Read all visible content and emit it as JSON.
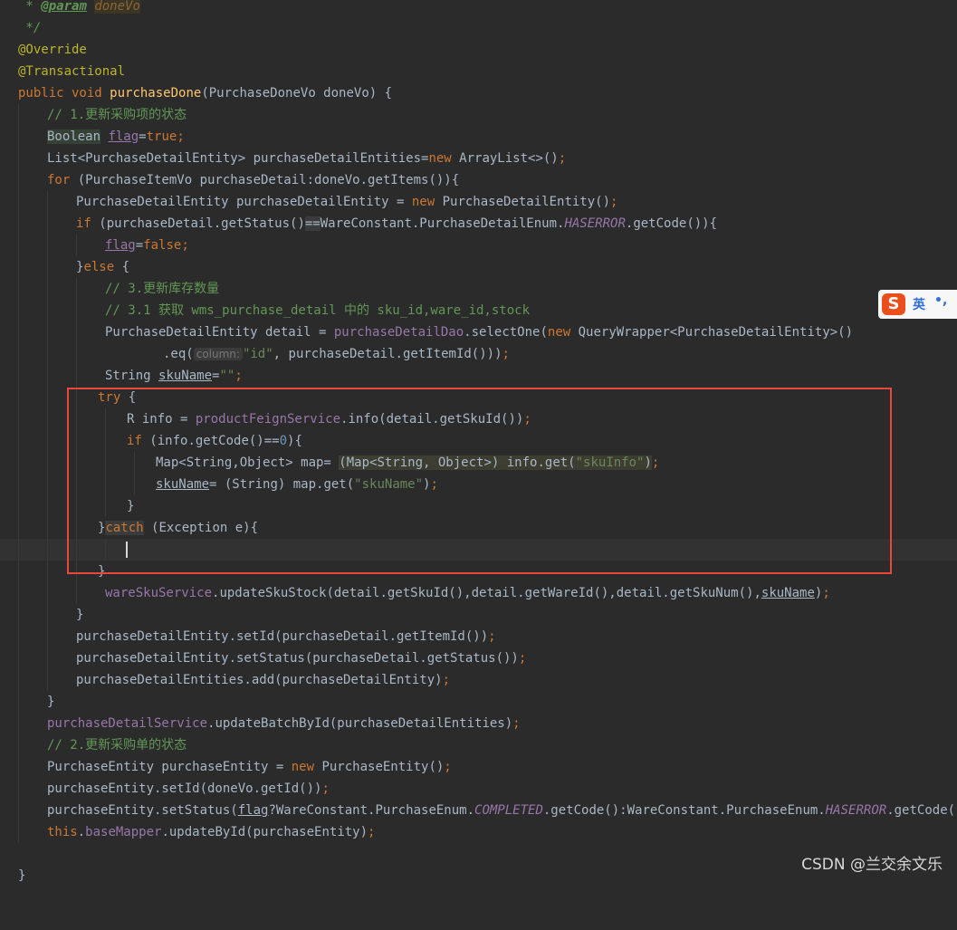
{
  "code": {
    "doc_star": " * ",
    "doc_param_tag": "@param",
    "doc_param_name": "doneVo",
    "doc_close": " */",
    "override": "@Override",
    "transactional": "@Transactional",
    "l3_public": "public void ",
    "l3_fn": "purchaseDone",
    "l3_rest": "(PurchaseDoneVo doneVo) {",
    "l4_comment": "// 1.更新采购项的状态",
    "l5_type": "Boolean",
    "l5_var": "flag",
    "l5_eq": "=",
    "l5_val": "true",
    "semi": ";",
    "l6_a": "List<PurchaseDetailEntity> purchaseDetailEntities=",
    "l6_new": "new ",
    "l6_b": "ArrayList<>()",
    "l7_for": "for ",
    "l7_rest": "(PurchaseItemVo purchaseDetail:doneVo.getItems()){",
    "l8_a": "PurchaseDetailEntity purchaseDetailEntity = ",
    "l8_new": "new ",
    "l8_b": "PurchaseDetailEntity()",
    "l9_if": "if ",
    "l9_a": "(purchaseDetail.getStatus()",
    "l9_eqeq": "==",
    "l9_b": "WareConstant.PurchaseDetailEnum.",
    "l9_enum": "HASERROR",
    "l9_c": ".getCode()){",
    "l10_var": "flag",
    "l10_eq": "=",
    "l10_val": "false",
    "l11_a": "}",
    "l11_else": "else ",
    "l11_b": "{",
    "l12_comment": "// 3.更新库存数量",
    "l13_comment": "// 3.1 获取 wms_purchase_detail 中的 sku_id,ware_id,stock",
    "l14_a": "PurchaseDetailEntity detail = ",
    "l14_dao": "purchaseDetailDao",
    "l14_b": ".selectOne(",
    "l14_new": "new ",
    "l14_c": "QueryWrapper<PurchaseDetailEntity>()",
    "l15_a": ".eq(",
    "l15_hint": "column:",
    "l15_str": "\"id\"",
    "l15_b": ", purchaseDetail.getItemId()))",
    "l16_a": "String ",
    "l16_var": "skuName",
    "l16_eq": "=",
    "l16_str": "\"\"",
    "l17_try": "try ",
    "l17_b": "{",
    "l18_a": "R info = ",
    "l18_svc": "productFeignService",
    "l18_b": ".info(detail.getSkuId())",
    "l19_if": "if ",
    "l19_a": "(info.getCode()==",
    "l19_num": "0",
    "l19_b": "){",
    "l20_a": "Map<String,Object> map= ",
    "l20_cast": "(Map<String, Object>)",
    "l20_b": " info.get(",
    "l20_str": "\"skuInfo\"",
    "l20_c": ")",
    "l21_var": "skuName",
    "l21_a": "= (String) map.get(",
    "l21_str": "\"skuName\"",
    "l21_b": ")",
    "close_brace": "}",
    "l23_a": "}",
    "l23_catch": "catch",
    "l23_b": " (Exception e){",
    "l26_svc": "wareSkuService",
    "l26_a": ".updateSkuStock(detail.getSkuId(),detail.getWareId(),detail.getSkuNum(),",
    "l26_var": "skuName",
    "l26_b": ")",
    "l28": "purchaseDetailEntity.setId(purchaseDetail.getItemId())",
    "l29": "purchaseDetailEntity.setStatus(purchaseDetail.getStatus())",
    "l30": "purchaseDetailEntities.add(purchaseDetailEntity)",
    "l32_svc": "purchaseDetailService",
    "l32_a": ".updateBatchById(purchaseDetailEntities)",
    "l33_comment": "// 2.更新采购单的状态",
    "l34_a": "PurchaseEntity purchaseEntity = ",
    "l34_new": "new ",
    "l34_b": "PurchaseEntity()",
    "l35": "purchaseEntity.setId(doneVo.getId())",
    "l36_a": "purchaseEntity.setStatus(",
    "l36_var": "flag",
    "l36_b": "?WareConstant.PurchaseEnum.",
    "l36_enum1": "COMPLETED",
    "l36_c": ".getCode():WareConstant.PurchaseEnum.",
    "l36_enum2": "HASERROR",
    "l36_d": ".getCode())",
    "l37_this": "this",
    "l37_dot": ".",
    "l37_mapper": "baseMapper",
    "l37_a": ".updateById(purchaseEntity)"
  },
  "ime": {
    "logo": "S",
    "lang": "英",
    "punct": "•,"
  },
  "watermark": "CSDN @兰交余文乐",
  "colors": {
    "background": "#2b2b2b",
    "highlight_box": "#e8473b",
    "keyword": "#cc7832",
    "string": "#6a8759",
    "field": "#9876aa",
    "method": "#ffc66d"
  }
}
